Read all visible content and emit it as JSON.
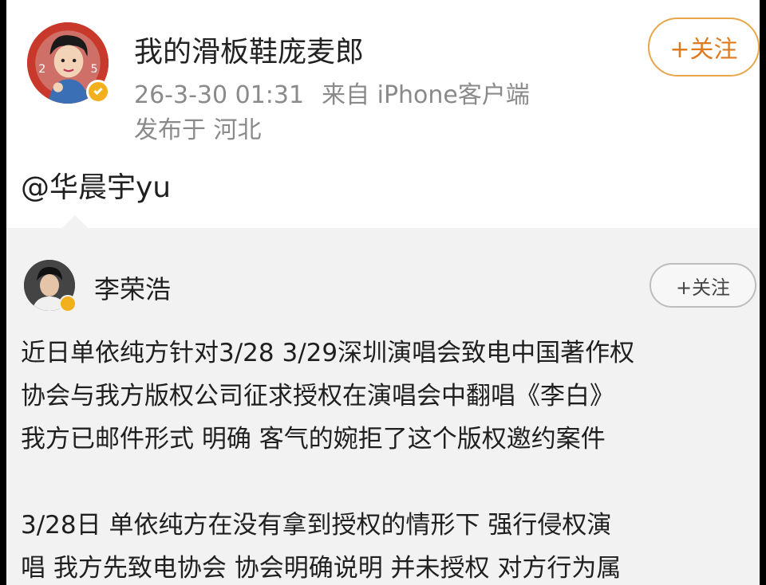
{
  "post": {
    "username": "我的滑板鞋庞麦郎",
    "date": "26-3-30 01:31",
    "source": "来自 iPhone客户端",
    "location": "发布于 河北",
    "follow_label": "+关注",
    "mention": "@华晨宇yu"
  },
  "repost": {
    "username": "李荣浩",
    "follow_label": "+关注",
    "lines": [
      "近日单依纯方针对3/28 3/29深圳演唱会致电中国著作权",
      "协会与我方版权公司征求授权在演唱会中翻唱《李白》",
      "我方已邮件形式 明确 客气的婉拒了这个版权邀约案件",
      "3/28日 单依纯方在没有拿到授权的情形下 强行侵权演",
      "唱  我方先致电协会 协会明确说明 并未授权 对方行为属"
    ]
  },
  "colors": {
    "follow_accent": "#e07a1f",
    "verified": "#f2b01e",
    "meta_gray": "#8a8a8a",
    "card_bg": "#f2f2f2"
  },
  "icons": {
    "verified": "verified-badge-icon"
  }
}
